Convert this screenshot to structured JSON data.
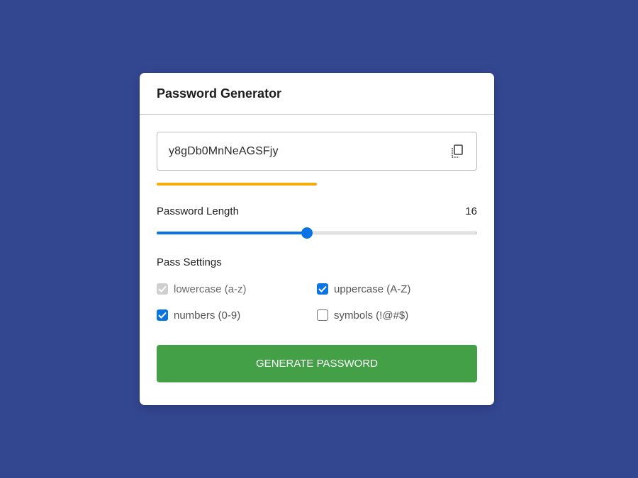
{
  "app": {
    "title": "Password Generator"
  },
  "password": {
    "value": "y8gDb0MnNeAGSFjy",
    "copy_icon": "copy-icon",
    "strength_fraction": 0.5,
    "strength_color": "#f5ab0a"
  },
  "length": {
    "label": "Password Length",
    "value": "16",
    "slider_fraction": 0.47,
    "accent": "#0b74e5"
  },
  "settings": {
    "label": "Pass Settings",
    "options": [
      {
        "label": "lowercase (a-z)",
        "state": "checked-disabled"
      },
      {
        "label": "uppercase (A-Z)",
        "state": "checked"
      },
      {
        "label": "numbers (0-9)",
        "state": "checked"
      },
      {
        "label": "symbols (!@#$)",
        "state": "unchecked"
      }
    ]
  },
  "generate": {
    "label": "Generate Password",
    "color": "#43a047"
  },
  "colors": {
    "background": "#334690",
    "card": "#ffffff"
  }
}
